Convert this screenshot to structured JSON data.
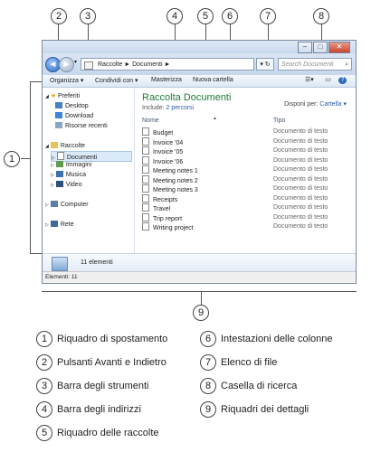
{
  "window": {
    "address": {
      "segments": [
        "Raccolte",
        "Documenti"
      ]
    },
    "search_placeholder": "Search Documenti",
    "toolbar": {
      "organize": "Organizza ▾",
      "share": "Condividi con ▾",
      "burn": "Masterizza",
      "new_folder": "Nuova cartella"
    },
    "nav": {
      "favorites": "Preferiti",
      "desktop": "Desktop",
      "download": "Download",
      "recent": "Risorse recenti",
      "libraries": "Raccolte",
      "documents": "Documenti",
      "images": "Immagini",
      "music": "Musica",
      "video": "Video",
      "computer": "Computer",
      "network": "Rete"
    },
    "library": {
      "title": "Raccolta Documenti",
      "include_label": "Include:",
      "include_link": "2 percorsi",
      "arrange_label": "Disponi per:",
      "arrange_value": "Cartella ▾"
    },
    "columns": {
      "name": "Nome",
      "type": "Tipo"
    },
    "files": [
      {
        "name": "Budget",
        "type": "Documento di testo"
      },
      {
        "name": "Invoice '04",
        "type": "Documento di testo"
      },
      {
        "name": "Invoice '05",
        "type": "Documento di testo"
      },
      {
        "name": "Invoice '06",
        "type": "Documento di testo"
      },
      {
        "name": "Meeting notes 1",
        "type": "Documento di testo"
      },
      {
        "name": "Meeting notes 2",
        "type": "Documento di testo"
      },
      {
        "name": "Meeting notes 3",
        "type": "Documento di testo"
      },
      {
        "name": "Receipts",
        "type": "Documento di testo"
      },
      {
        "name": "Travel",
        "type": "Documento di testo"
      },
      {
        "name": "Trip report",
        "type": "Documento di testo"
      },
      {
        "name": "Writing project",
        "type": "Documento di testo"
      }
    ],
    "details": {
      "count": "11 elementi"
    },
    "status": "Elementi: 11"
  },
  "callouts": [
    "1",
    "2",
    "3",
    "4",
    "5",
    "6",
    "7",
    "8",
    "9"
  ],
  "legend": [
    {
      "num": "1",
      "text": "Riquadro di spostamento"
    },
    {
      "num": "2",
      "text": "Pulsanti Avanti e Indietro"
    },
    {
      "num": "3",
      "text": "Barra degli strumenti"
    },
    {
      "num": "4",
      "text": "Barra degli indirizzi"
    },
    {
      "num": "5",
      "text": "Riquadro delle raccolte"
    },
    {
      "num": "6",
      "text": "Intestazioni delle colonne"
    },
    {
      "num": "7",
      "text": "Elenco di file"
    },
    {
      "num": "8",
      "text": "Casella di ricerca"
    },
    {
      "num": "9",
      "text": "Riquadri dei dettagli"
    }
  ]
}
